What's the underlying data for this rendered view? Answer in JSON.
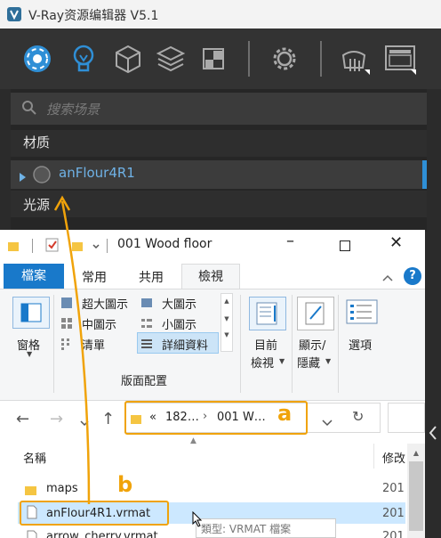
{
  "vray": {
    "title": "V-Ray资源编辑器 V5.1",
    "search_placeholder": "搜索场景",
    "category_materials": "材质",
    "material_item": "anFlour4R1",
    "category_lights": "光源",
    "toolbar_icons": [
      "materials-icon",
      "lights-icon",
      "geometry-icon",
      "layers-icon",
      "render-elements-icon",
      "settings-icon",
      "teapot-render-icon",
      "vfb-window-icon"
    ]
  },
  "explorer": {
    "title": "001 Wood floor",
    "tabs": {
      "file": "檔案",
      "home": "常用",
      "share": "共用",
      "view": "檢視"
    },
    "nav_pane": "窗格",
    "layout": {
      "extra_large": "超大圖示",
      "large": "大圖示",
      "medium": "中圖示",
      "small": "小圖示",
      "list": "清單",
      "details": "詳細資料",
      "group_label": "版面配置"
    },
    "current_view_line1": "目前",
    "current_view_line2": "檢視",
    "show_hide_line1": "顯示/",
    "show_hide_line2": "隱藏",
    "options": "選項",
    "address": {
      "sep": "«",
      "part1": "182…",
      "part2": "001 W…"
    },
    "col_name": "名稱",
    "col_modified": "修改",
    "files": [
      {
        "name": "maps",
        "date": "201"
      },
      {
        "name": "anFlour4R1.vrmat",
        "date": "201"
      },
      {
        "name": "arrow_cherry.vrmat",
        "date": "201"
      }
    ],
    "tooltip": "類型: VRMAT 檔案"
  },
  "annotations": {
    "a": "a",
    "b": "b"
  },
  "colors": {
    "accent_blue": "#2f8fd6",
    "annotation_orange": "#f0a30a",
    "file_tab_blue": "#1979ca"
  }
}
